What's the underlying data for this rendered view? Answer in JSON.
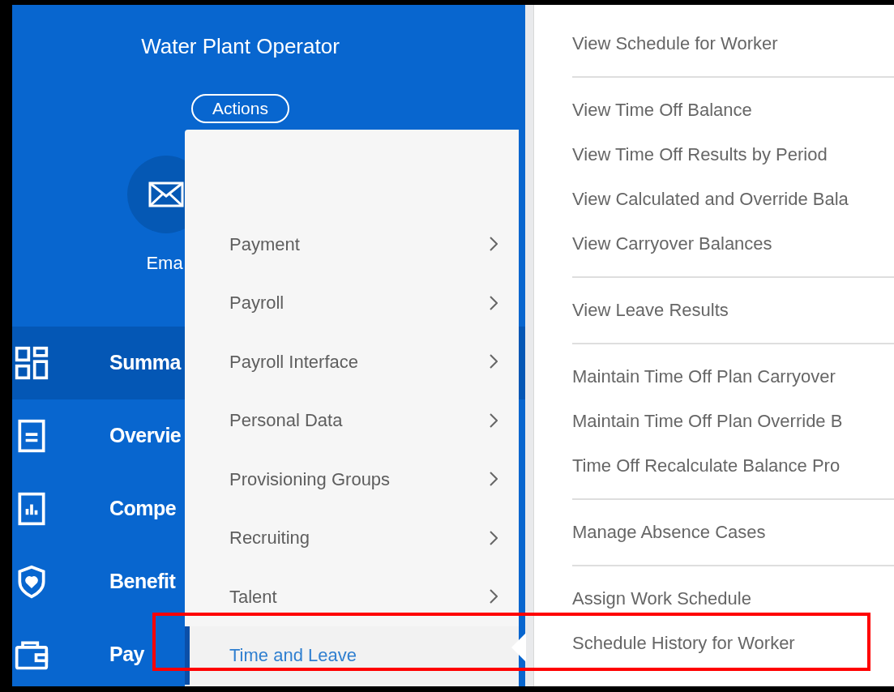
{
  "header": {
    "job_title": "Water Plant Operator",
    "actions_button": "Actions"
  },
  "quick_action": {
    "label": "Ema"
  },
  "sidebar": {
    "items": [
      {
        "label": "Summa",
        "kind": "grid",
        "selected": true
      },
      {
        "label": "Overvie",
        "kind": "document",
        "selected": false
      },
      {
        "label": "Compe",
        "kind": "chart",
        "selected": false
      },
      {
        "label": "Benefit",
        "kind": "shield",
        "selected": false
      },
      {
        "label": "Pay",
        "kind": "wallet",
        "selected": false
      }
    ]
  },
  "actions_menu": {
    "items": [
      {
        "label": "Payment",
        "selected": false
      },
      {
        "label": "Payroll",
        "selected": false
      },
      {
        "label": "Payroll Interface",
        "selected": false
      },
      {
        "label": "Personal Data",
        "selected": false
      },
      {
        "label": "Provisioning Groups",
        "selected": false
      },
      {
        "label": "Recruiting",
        "selected": false
      },
      {
        "label": "Talent",
        "selected": false
      },
      {
        "label": "Time and Leave",
        "selected": true
      }
    ]
  },
  "submenu": {
    "groups": [
      {
        "items": [
          "View Schedule for Worker"
        ]
      },
      {
        "items": [
          "View Time Off Balance",
          "View Time Off Results by Period",
          "View Calculated and Override Bala",
          "View Carryover Balances"
        ]
      },
      {
        "items": [
          "View Leave Results"
        ]
      },
      {
        "items": [
          "Maintain Time Off Plan Carryover",
          "Maintain Time Off Plan Override B",
          "Time Off Recalculate Balance Pro"
        ]
      },
      {
        "items": [
          "Manage Absence Cases"
        ]
      },
      {
        "items": [
          "Assign Work Schedule",
          "Schedule History for Worker"
        ]
      }
    ]
  }
}
